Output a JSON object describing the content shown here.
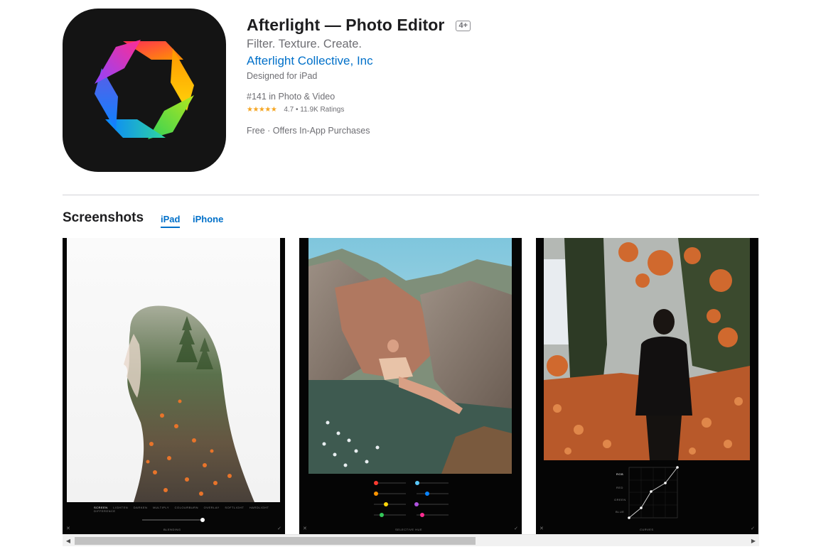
{
  "app": {
    "title": "Afterlight — Photo Editor",
    "age_rating": "4+",
    "subtitle": "Filter. Texture. Create.",
    "developer": "Afterlight Collective, Inc",
    "designed_for": "Designed for iPad",
    "rank": "#141 in Photo & Video",
    "stars": "★★★★★",
    "rating": "4.7 • 11.9K Ratings",
    "rating_value": 4.7,
    "price": "Free · Offers In-App Purchases",
    "icon": "afterlight-aperture-icon"
  },
  "screenshots": {
    "title": "Screenshots",
    "tabs": [
      {
        "label": "iPad",
        "active": true
      },
      {
        "label": "iPhone",
        "active": false
      }
    ],
    "items": [
      {
        "description_icon": "double-exposure-portrait",
        "blend_modes": [
          "SCREEN",
          "LIGHTEN",
          "DARKEN",
          "MULTIPLY",
          "COLOURBURN",
          "OVERLAY",
          "SOFTLIGHT",
          "HARDLIGHT",
          "DIFFERENCE"
        ],
        "bottom_label": "BLENDING"
      },
      {
        "description_icon": "girl-on-rocks",
        "bottom_label": "SELECTIVE HUE"
      },
      {
        "description_icon": "autumn-person-walking",
        "curve_labels": [
          "RGB",
          "RED",
          "GREEN",
          "BLUE"
        ],
        "bottom_label": "CURVES"
      }
    ]
  },
  "colors": {
    "link": "#0070c9",
    "star": "#f5a623",
    "text_secondary": "#6e6e73"
  }
}
